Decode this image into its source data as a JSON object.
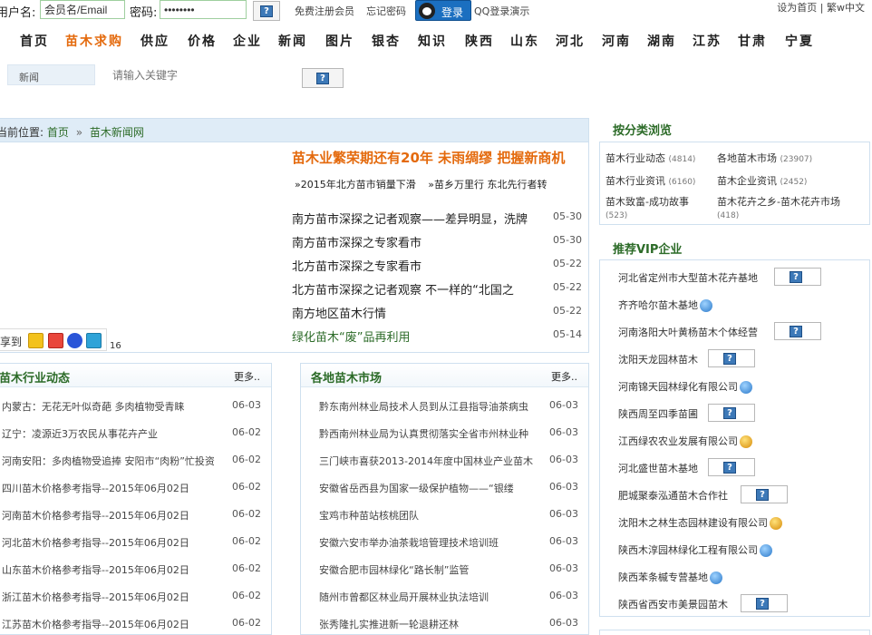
{
  "top": {
    "user_label": "用户名:",
    "user_value": "会员名/Email",
    "pass_label": "密码:",
    "pass_value": "••••••••",
    "register": "免费注册会员",
    "forgot": "忘记密码",
    "login": "登录",
    "qq_demo": "QQ登录演示",
    "right_links": "设为首页 | 繁w中文"
  },
  "nav": [
    "首页",
    "苗木求购",
    "供应",
    "价格",
    "企业",
    "新闻",
    "图片",
    "银杏",
    "知识",
    "陕西",
    "山东",
    "河北",
    "河南",
    "湖南",
    "江苏",
    "甘肃",
    "宁夏"
  ],
  "search": {
    "category": "新闻",
    "placeholder": "请输入关键字"
  },
  "breadcrumb": {
    "prefix": "当前位置:",
    "home": "首页",
    "sep": "»",
    "current": "苗木新闻网"
  },
  "headline": "苗木业繁荣期还有20年 未雨绸缪 把握新商机",
  "sublinks": [
    "»2015年北方苗市销量下滑",
    "»苗乡万里行 东北先行者转"
  ],
  "news": [
    {
      "title": "南方苗市深探之记者观察——差异明显，洗牌",
      "date": "05-30"
    },
    {
      "title": "南方苗市深探之专家看市",
      "date": "05-30"
    },
    {
      "title": "北方苗市深探之专家看市",
      "date": "05-22"
    },
    {
      "title": "北方苗市深探之记者观察 不一样的“北国之",
      "date": "05-22"
    },
    {
      "title": "南方地区苗木行情",
      "date": "05-22"
    },
    {
      "title": "绿化苗木“废”品再利用",
      "date": "05-14"
    }
  ],
  "share": {
    "label": "分享到",
    "count": "16"
  },
  "panels": {
    "industry": {
      "title": "苗木行业动态",
      "more": "更多..",
      "items": [
        {
          "title": "内蒙古：无花无叶似奇葩 多肉植物受青睐",
          "date": "06-03"
        },
        {
          "title": "辽宁：凌源近3万农民从事花卉产业",
          "date": "06-02"
        },
        {
          "title": "河南安阳：多肉植物受追捧 安阳市“肉粉”忙投资",
          "date": "06-02"
        },
        {
          "title": "四川苗木价格参考指导--2015年06月02日",
          "date": "06-02"
        },
        {
          "title": "河南苗木价格参考指导--2015年06月02日",
          "date": "06-02"
        },
        {
          "title": "河北苗木价格参考指导--2015年06月02日",
          "date": "06-02"
        },
        {
          "title": "山东苗木价格参考指导--2015年06月02日",
          "date": "06-02"
        },
        {
          "title": "浙江苗木价格参考指导--2015年06月02日",
          "date": "06-02"
        },
        {
          "title": "江苏苗木价格参考指导--2015年06月02日",
          "date": "06-02"
        }
      ]
    },
    "market": {
      "title": "各地苗木市场",
      "more": "更多..",
      "items": [
        {
          "title": "黔东南州林业局技术人员到从江县指导油茶病虫",
          "date": "06-03"
        },
        {
          "title": "黔西南州林业局为认真贯彻落实全省市州林业种",
          "date": "06-03"
        },
        {
          "title": "三门峡市喜获2013-2014年度中国林业产业苗木",
          "date": "06-03"
        },
        {
          "title": "安徽省岳西县为国家一级保护植物——“银缕",
          "date": "06-03"
        },
        {
          "title": "宝鸡市种苗站核桃团队",
          "date": "06-03"
        },
        {
          "title": "安徽六安市举办油茶栽培管理技术培训班",
          "date": "06-03"
        },
        {
          "title": "安徽合肥市园林绿化“路长制”监管",
          "date": "06-03"
        },
        {
          "title": "随州市曾都区林业局开展林业执法培训",
          "date": "06-03"
        },
        {
          "title": "张秀隆扎实推进新一轮退耕还林",
          "date": "06-03"
        }
      ]
    }
  },
  "categories": {
    "title": "按分类浏览",
    "items": [
      {
        "name": "苗木行业动态",
        "count": "(4814)"
      },
      {
        "name": "各地苗木市场",
        "count": "(23907)"
      },
      {
        "name": "苗木行业资讯",
        "count": "(6160)"
      },
      {
        "name": "苗木企业资讯",
        "count": "(2452)"
      },
      {
        "name": "苗木致富-成功故事",
        "count": "(523)"
      },
      {
        "name": "苗木花卉之乡-苗木花卉市场",
        "count": "(418)"
      }
    ]
  },
  "vip": {
    "title": "推荐VIP企业",
    "items": [
      {
        "name": "河北省定州市大型苗木花卉基地",
        "badge": "qq"
      },
      {
        "name": "齐齐哈尔苗木基地",
        "badge": "blue"
      },
      {
        "name": "河南洛阳大叶黄杨苗木个体经营",
        "badge": "qq"
      },
      {
        "name": "沈阳天龙园林苗木",
        "badge": "qq"
      },
      {
        "name": "河南锦天园林绿化有限公司",
        "badge": "blue"
      },
      {
        "name": "陕西周至四季苗圃",
        "badge": "qq"
      },
      {
        "name": "江西绿农农业发展有限公司",
        "badge": "gold"
      },
      {
        "name": "河北盛世苗木基地",
        "badge": "qq"
      },
      {
        "name": "肥城聚泰泓通苗木合作社",
        "badge": "qq"
      },
      {
        "name": "沈阳木之林生态园林建设有限公司",
        "badge": "gold"
      },
      {
        "name": "陕西木淳园林绿化工程有限公司",
        "badge": "blue"
      },
      {
        "name": "陕西苯条槭专营基地",
        "badge": "blue"
      },
      {
        "name": "陕西省西安市美景园苗木",
        "badge": "qq"
      }
    ]
  },
  "colors": {
    "accent": "#e46a0d",
    "green_title": "#2c6b28",
    "blue_bar": "#dfecf7"
  }
}
